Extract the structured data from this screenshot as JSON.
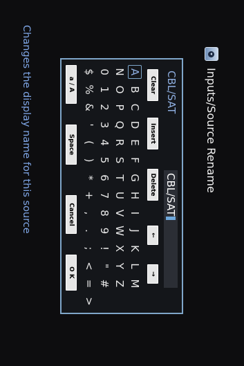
{
  "header": {
    "icon": "input-source-icon",
    "title": "Inputs/Source Rename"
  },
  "current_source": "CBL/SAT",
  "name_field": {
    "value": "CBL/SAT"
  },
  "buttons": {
    "clear": "Clear",
    "insert": "Insert",
    "delete": "Delete",
    "left": "←",
    "right": "→",
    "case": "a / A",
    "space": "Space",
    "cancel": "Cancel",
    "ok": "O K"
  },
  "keyboard": {
    "rows": [
      [
        "A",
        "B",
        "C",
        "D",
        "E",
        "F",
        "G",
        "H",
        "I",
        "J",
        "K",
        "L",
        "M"
      ],
      [
        "N",
        "O",
        "P",
        "Q",
        "R",
        "S",
        "T",
        "U",
        "V",
        "W",
        "X",
        "Y",
        "Z"
      ],
      [
        "0",
        "1",
        "2",
        "3",
        "4",
        "5",
        "6",
        "7",
        "8",
        "9",
        "!",
        "\"",
        "#"
      ],
      [
        "$",
        "%",
        "&",
        "'",
        "(",
        ")",
        "*",
        "+",
        ",",
        ".",
        ";",
        "<",
        "=",
        ">"
      ]
    ],
    "selected": "A"
  },
  "hint": "Changes the display name for this source"
}
